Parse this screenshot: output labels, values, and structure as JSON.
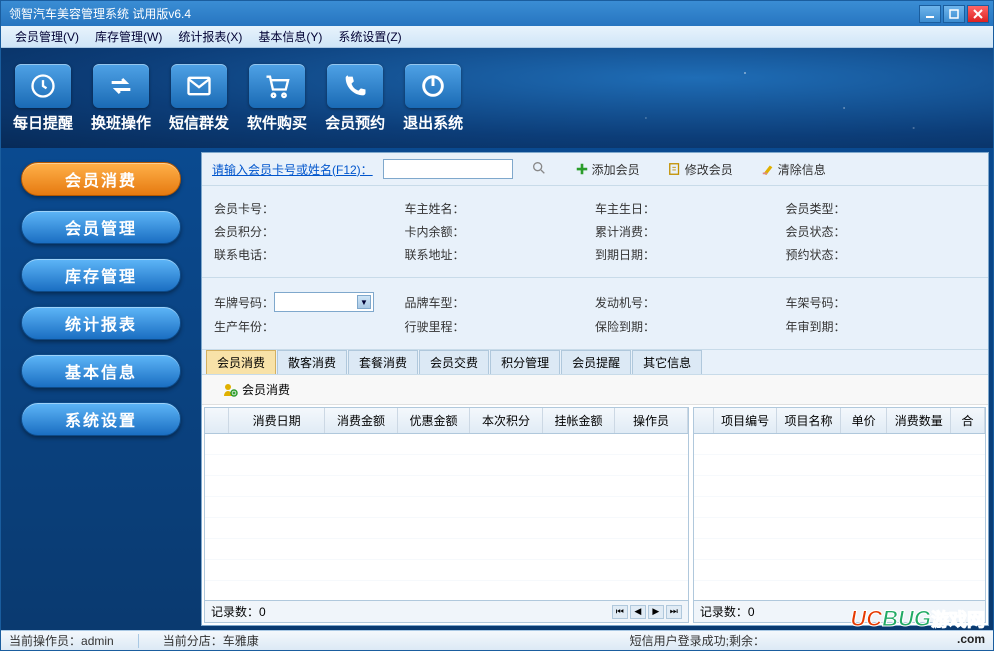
{
  "window": {
    "title": "领智汽车美容管理系统 试用版v6.4"
  },
  "menubar": [
    {
      "label": "会员管理(V)"
    },
    {
      "label": "库存管理(W)"
    },
    {
      "label": "统计报表(X)"
    },
    {
      "label": "基本信息(Y)"
    },
    {
      "label": "系统设置(Z)"
    }
  ],
  "toolbar": [
    {
      "label": "每日提醒",
      "icon": "clock-icon"
    },
    {
      "label": "换班操作",
      "icon": "swap-icon"
    },
    {
      "label": "短信群发",
      "icon": "mail-icon"
    },
    {
      "label": "软件购买",
      "icon": "cart-icon"
    },
    {
      "label": "会员预约",
      "icon": "phone-icon"
    },
    {
      "label": "退出系统",
      "icon": "power-icon"
    }
  ],
  "leftnav": [
    {
      "label": "会员消费",
      "active": true
    },
    {
      "label": "会员管理"
    },
    {
      "label": "库存管理"
    },
    {
      "label": "统计报表"
    },
    {
      "label": "基本信息"
    },
    {
      "label": "系统设置"
    }
  ],
  "searchbar": {
    "prompt": "请输入会员卡号或姓名(F12)：",
    "value": "",
    "add": "添加会员",
    "edit": "修改会员",
    "clear": "清除信息"
  },
  "member_info": {
    "row1": {
      "card_no": "会员卡号：",
      "owner_name": "车主姓名：",
      "owner_bday": "车主生日：",
      "type": "会员类型："
    },
    "row2": {
      "points": "会员积分：",
      "balance": "卡内余额：",
      "total_spend": "累计消费：",
      "status": "会员状态："
    },
    "row3": {
      "phone": "联系电话：",
      "address": "联系地址：",
      "expire": "到期日期：",
      "reserve": "预约状态："
    }
  },
  "car_info": {
    "row1": {
      "plate": "车牌号码：",
      "brand": "品牌车型：",
      "engine": "发动机号：",
      "vin": "车架号码："
    },
    "row2": {
      "year": "生产年份：",
      "mileage": "行驶里程：",
      "insurance": "保险到期：",
      "inspection": "年审到期："
    }
  },
  "tabs": [
    {
      "label": "会员消费",
      "active": true
    },
    {
      "label": "散客消费"
    },
    {
      "label": "套餐消费"
    },
    {
      "label": "会员交费"
    },
    {
      "label": "积分管理"
    },
    {
      "label": "会员提醒"
    },
    {
      "label": "其它信息"
    }
  ],
  "tabcontent": {
    "heading": "会员消费",
    "grid_left": {
      "cols": [
        "",
        "消费日期",
        "消费金额",
        "优惠金额",
        "本次积分",
        "挂帐金额",
        "操作员"
      ],
      "record_label": "记录数：",
      "record_count": "0"
    },
    "grid_right": {
      "cols": [
        "",
        "项目编号",
        "项目名称",
        "单价",
        "消费数量",
        "合"
      ],
      "record_label": "记录数：",
      "record_count": "0"
    }
  },
  "statusbar": {
    "operator_label": "当前操作员：",
    "operator": "admin",
    "branch_label": "当前分店：",
    "branch": "车雅康",
    "sms": "短信用户登录成功;剩余："
  },
  "watermark": {
    "uc": "UC",
    "bug": "BUG",
    "cn": "游戏网",
    "com": ".com"
  }
}
